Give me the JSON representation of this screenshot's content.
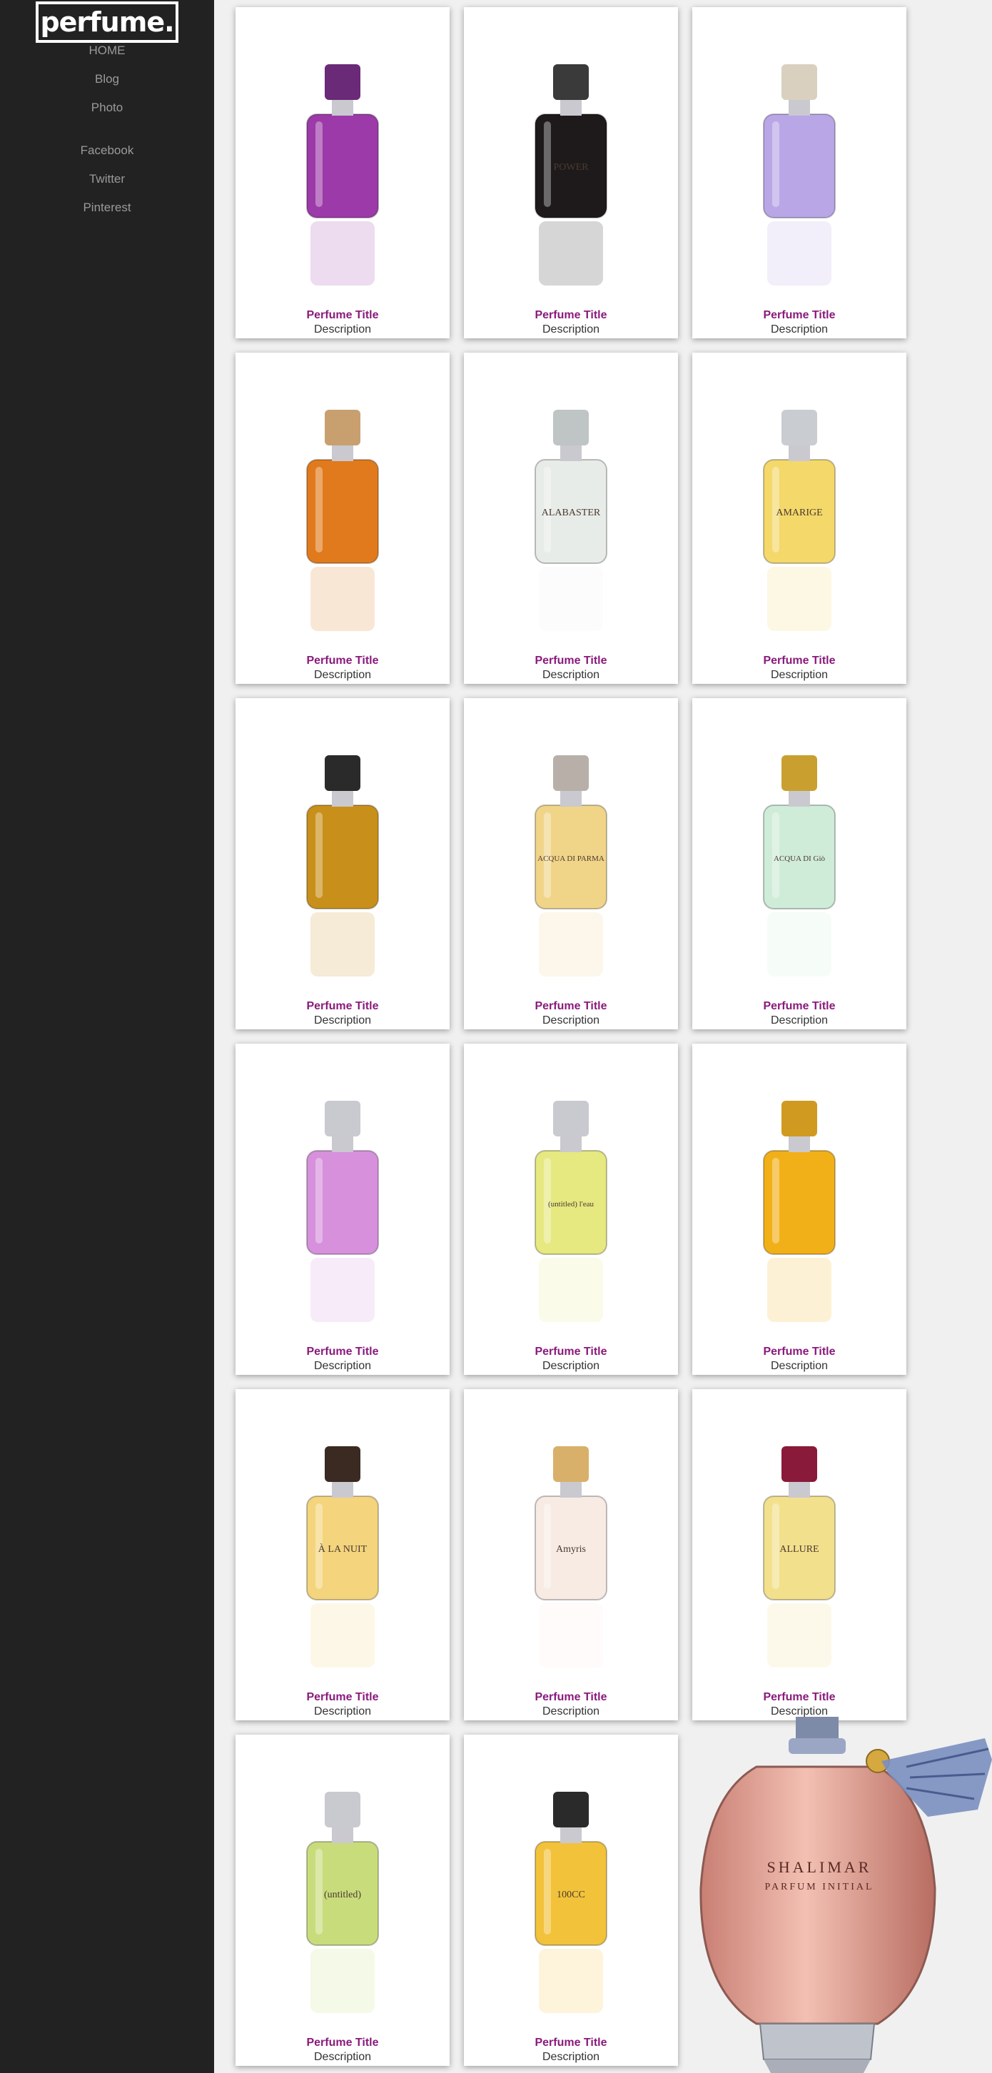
{
  "brand": {
    "logo": "perfume."
  },
  "nav": {
    "home": "HOME",
    "blog": "Blog",
    "photo": "Photo"
  },
  "social": {
    "facebook": "Facebook",
    "twitter": "Twitter",
    "pinterest": "Pinterest"
  },
  "products": [
    {
      "title": "Perfume Title",
      "description": "Description",
      "label": "",
      "bottle_color": "#9b3aa8",
      "cap_color": "#6a2a78"
    },
    {
      "title": "Perfume Title",
      "description": "Description",
      "label": "POWER",
      "bottle_color": "#1e1a1c",
      "cap_color": "#3a3a3a"
    },
    {
      "title": "Perfume Title",
      "description": "Description",
      "label": "",
      "bottle_color": "#b9a6e6",
      "cap_color": "#d9d0c0"
    },
    {
      "title": "Perfume Title",
      "description": "Description",
      "label": "",
      "bottle_color": "#e07a1c",
      "cap_color": "#c8a070"
    },
    {
      "title": "Perfume Title",
      "description": "Description",
      "label": "ALABASTER",
      "bottle_color": "#e8ece8",
      "cap_color": "#bfc4c4"
    },
    {
      "title": "Perfume Title",
      "description": "Description",
      "label": "AMARIGE",
      "bottle_color": "#f4d86a",
      "cap_color": "#c9cdd2"
    },
    {
      "title": "Perfume Title",
      "description": "Description",
      "label": "",
      "bottle_color": "#c8901a",
      "cap_color": "#2a2a2a"
    },
    {
      "title": "Perfume Title",
      "description": "Description",
      "label": "ACQUA DI PARMA",
      "bottle_color": "#f0d488",
      "cap_color": "#b8b0a8"
    },
    {
      "title": "Perfume Title",
      "description": "Description",
      "label": "ACQUA DI Giò",
      "bottle_color": "#cfecd8",
      "cap_color": "#c9a030"
    },
    {
      "title": "Perfume Title",
      "description": "Description",
      "label": "",
      "bottle_color": "#d690dc",
      "cap_color": "#c9c9d0"
    },
    {
      "title": "Perfume Title",
      "description": "Description",
      "label": "(untitled) l'eau",
      "bottle_color": "#e6e880",
      "cap_color": "#c9c9d0"
    },
    {
      "title": "Perfume Title",
      "description": "Description",
      "label": "",
      "bottle_color": "#f2b018",
      "cap_color": "#d09a20"
    },
    {
      "title": "Perfume Title",
      "description": "Description",
      "label": "À LA NUIT",
      "bottle_color": "#f4d47c",
      "cap_color": "#3a2a22"
    },
    {
      "title": "Perfume Title",
      "description": "Description",
      "label": "Amyris",
      "bottle_color": "#f8ebe4",
      "cap_color": "#d8b06a"
    },
    {
      "title": "Perfume Title",
      "description": "Description",
      "label": "ALLURE",
      "bottle_color": "#f2e08c",
      "cap_color": "#8a1a3a"
    },
    {
      "title": "Perfume Title",
      "description": "Description",
      "label": "(untitled)",
      "bottle_color": "#c8dc7c",
      "cap_color": "#c9c9d0"
    },
    {
      "title": "Perfume Title",
      "description": "Description",
      "label": "100CC",
      "bottle_color": "#f2c23a",
      "cap_color": "#2a2a2a"
    }
  ],
  "hero": {
    "label_line1": "SHALIMAR",
    "label_line2": "PARFUM INITIAL",
    "bottle_color": "#e7a596",
    "tassel_color": "#7a8fc0"
  }
}
